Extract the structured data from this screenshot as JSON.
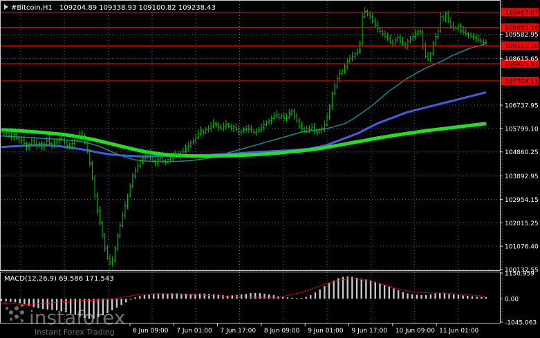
{
  "header": {
    "symbol": "#Bitcoin,H1",
    "ohlc": "109204.89 109338.93 109100.82 109238.43"
  },
  "macd_header": "MACD(12,26,9) 69.586 171.543",
  "watermark": {
    "brand": "instaforex",
    "tagline": "Instant Forex Trading"
  },
  "colors": {
    "background": "#000000",
    "frame": "#d0d0d0",
    "grid": "#5a5a6a",
    "candle": "#00c800",
    "ma_fast": "#178c8c",
    "ma_mid": "#4060e0",
    "ma_slow": "#20e020",
    "level": "#ff0000",
    "level_label_bg": "#ff0000",
    "macd_hist": "#c8c8c8",
    "macd_signal": "#ff0000"
  },
  "price_axis": {
    "ticks": [
      "109582.95",
      "108615.65",
      "106737.95",
      "105799.10",
      "104860.25",
      "103892.95",
      "102954.15",
      "102015.25",
      "101076.40",
      "100137.55"
    ]
  },
  "levels": [
    {
      "label": "110467.07",
      "value": 110467.07
    },
    {
      "label": "109853.16",
      "value": 109853.16
    },
    {
      "label": "109121.20",
      "value": 109121.2
    },
    {
      "label": "108405.91",
      "value": 108405.91
    },
    {
      "label": "107708.11",
      "value": 107708.11
    }
  ],
  "macd_axis": {
    "ticks": [
      "1150.959",
      "0.00",
      "-1045.063"
    ]
  },
  "time_axis": {
    "labels": [
      "6 Jun 09:00",
      "7 Jun 01:00",
      "7 Jun 17:00",
      "8 Jun 09:00",
      "9 Jun 01:00",
      "9 Jun 17:00",
      "10 Jun 09:00",
      "11 Jun 01:00"
    ]
  },
  "chart_data": {
    "type": "candlestick",
    "timeframe": "H1",
    "symbol": "#Bitcoin",
    "ylim": [
      100137.55,
      110900
    ],
    "closes": [
      105700,
      105600,
      105650,
      105500,
      105450,
      105560,
      105400,
      105300,
      105350,
      105200,
      105050,
      105150,
      105300,
      105250,
      105100,
      105200,
      105050,
      105150,
      105300,
      105200,
      105100,
      105250,
      105300,
      105400,
      105350,
      105250,
      105100,
      105050,
      105200,
      105350,
      105400,
      105600,
      105450,
      105250,
      104900,
      104400,
      103800,
      103100,
      102500,
      102000,
      101500,
      101000,
      100600,
      100400,
      100500,
      101000,
      101500,
      101900,
      102300,
      102700,
      103100,
      103500,
      103900,
      104100,
      104300,
      104500,
      104600,
      104700,
      104800,
      104650,
      104500,
      104400,
      104550,
      104650,
      104500,
      104450,
      104550,
      104600,
      104700,
      104750,
      104800,
      104700,
      104900,
      105000,
      105100,
      105250,
      105300,
      105450,
      105600,
      105700,
      105650,
      105750,
      105800,
      105900,
      106000,
      105950,
      105850,
      105800,
      105900,
      105950,
      105900,
      105800,
      105850,
      105750,
      105650,
      105700,
      105750,
      105800,
      105750,
      105700,
      105650,
      105700,
      105750,
      105850,
      105950,
      106050,
      106100,
      106200,
      106300,
      106350,
      106250,
      106300,
      106200,
      106250,
      106400,
      106500,
      106300,
      106100,
      105900,
      105800,
      105700,
      105800,
      105750,
      105850,
      105700,
      105650,
      105700,
      105800,
      105950,
      106250,
      106700,
      107200,
      107500,
      107800,
      108000,
      108100,
      108300,
      108500,
      108600,
      108700,
      108800,
      108900,
      109200,
      110300,
      110500,
      110400,
      110300,
      110100,
      109950,
      109800,
      109700,
      109600,
      109500,
      109400,
      109300,
      109200,
      109350,
      109450,
      109300,
      109200,
      109100,
      109300,
      109400,
      109500,
      109600,
      109700,
      109650,
      109100,
      108700,
      108600,
      108800,
      109200,
      109500,
      109700,
      110300,
      110200,
      110400,
      110100,
      109900,
      109850,
      109800,
      109900,
      109750,
      109650,
      109600,
      109550,
      109500,
      109450,
      109400,
      109350,
      109300,
      109250,
      109238.43
    ],
    "series": [
      {
        "name": "MA fast",
        "values": [
          105500,
          105480,
          105460,
          105440,
          105420,
          105400,
          105380,
          105350,
          105320,
          105280,
          105200,
          105100,
          104950,
          104800,
          104650,
          104550,
          104500,
          104480,
          104470,
          104470,
          104480,
          104500,
          104530,
          104580,
          104650,
          104750,
          104850,
          104950,
          105050,
          105150,
          105250,
          105350,
          105450,
          105550,
          105650,
          105700,
          105750,
          105800,
          105900,
          106000,
          106200,
          106450,
          106700,
          107000,
          107300,
          107550,
          107800,
          108000,
          108200,
          108350,
          108500,
          108700,
          108850,
          109000,
          109100,
          109200
        ]
      },
      {
        "name": "MA mid",
        "values": [
          105050,
          105080,
          105100,
          105120,
          105130,
          105120,
          105080,
          105030,
          104970,
          104900,
          104820,
          104760,
          104720,
          104700,
          104680,
          104680,
          104690,
          104700,
          104710,
          104720,
          104730,
          104740,
          104760,
          104780,
          104800,
          104830,
          104860,
          104880,
          104900,
          104920,
          104950,
          104980,
          105050,
          105150,
          105300,
          105450,
          105600,
          105800,
          106000,
          106150,
          106300,
          106450,
          106550,
          106650,
          106750,
          106850,
          106950,
          107050,
          107150,
          107250
        ]
      },
      {
        "name": "MA slow",
        "values": [
          105750,
          105730,
          105700,
          105670,
          105640,
          105600,
          105560,
          105500,
          105430,
          105350,
          105250,
          105150,
          105050,
          104950,
          104860,
          104800,
          104750,
          104720,
          104700,
          104690,
          104690,
          104700,
          104710,
          104720,
          104740,
          104760,
          104790,
          104820,
          104860,
          104900,
          104950,
          105000,
          105080,
          105150,
          105230,
          105300,
          105380,
          105450,
          105520,
          105580,
          105640,
          105700,
          105750,
          105800,
          105850,
          105900,
          105950,
          106000
        ]
      }
    ],
    "macd": {
      "ylim": [
        -1045.063,
        1150.959
      ],
      "histogram": [
        -100,
        -120,
        -140,
        -160,
        -200,
        -260,
        -320,
        -380,
        -420,
        -460,
        -480,
        -500,
        -520,
        -560,
        -600,
        -660,
        -720,
        -800,
        -860,
        -900,
        -880,
        -820,
        -740,
        -640,
        -520,
        -400,
        -280,
        -160,
        -40,
        60,
        120,
        160,
        180,
        200,
        210,
        220,
        230,
        240,
        240,
        230,
        220,
        210,
        220,
        230,
        230,
        220,
        200,
        180,
        160,
        140,
        150,
        170,
        190,
        220,
        250,
        260,
        250,
        220,
        190,
        160,
        120,
        80,
        60,
        40,
        30,
        40,
        80,
        160,
        280,
        420,
        560,
        700,
        820,
        920,
        980,
        1000,
        980,
        940,
        900,
        860,
        820,
        760,
        700,
        620,
        540,
        460,
        380,
        300,
        240,
        200,
        180,
        170,
        160,
        200,
        240,
        260,
        240,
        210,
        190,
        170,
        150,
        130,
        110,
        90,
        80,
        70
      ],
      "signal": [
        -180,
        -200,
        -220,
        -240,
        -250,
        -250,
        -240,
        -220,
        -200,
        -180,
        -160,
        -140,
        -120,
        -100,
        -90,
        -80,
        -70,
        -60,
        -50,
        -30,
        0,
        40,
        80,
        120,
        160,
        190,
        210,
        220,
        230,
        230,
        220,
        210,
        200,
        190,
        180,
        170,
        160,
        150,
        140,
        130,
        120,
        110,
        100,
        90,
        80,
        70,
        60,
        50,
        40,
        60,
        90,
        130,
        180,
        240,
        300,
        380,
        470,
        560,
        650,
        730,
        800,
        850,
        880,
        890,
        880,
        850,
        800,
        740,
        670,
        600,
        530,
        460,
        400,
        350,
        310,
        290,
        270,
        260,
        260,
        260,
        250,
        230,
        210,
        190,
        170,
        150,
        130,
        110
      ]
    }
  }
}
